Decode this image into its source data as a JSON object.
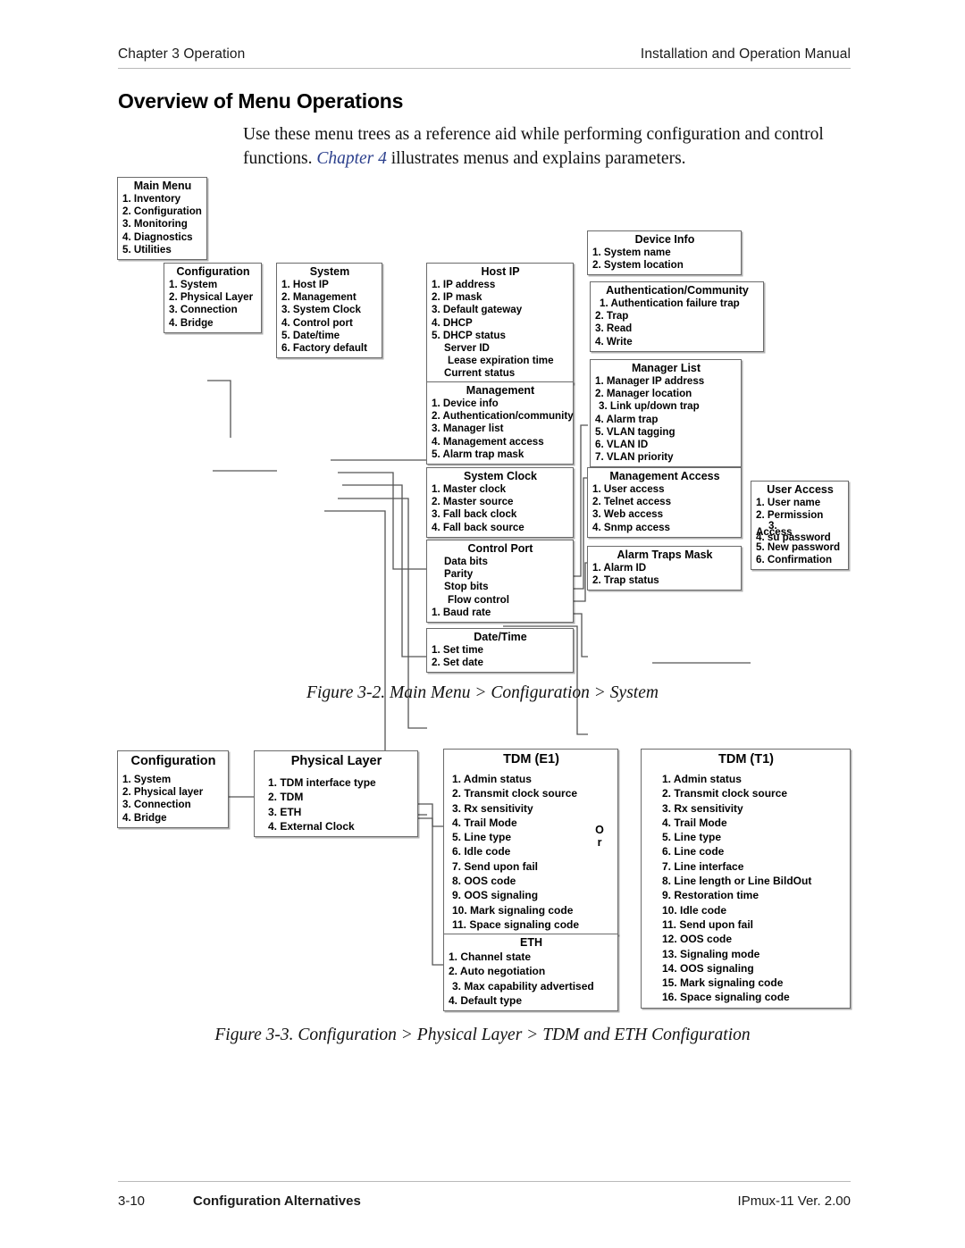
{
  "header": {
    "left": "Chapter 3  Operation",
    "right": "Installation and Operation Manual"
  },
  "section": {
    "title": "Overview of Menu Operations",
    "intro_part1": "Use these menu trees as a reference aid while performing configuration and control functions. ",
    "intro_xref": "Chapter 4",
    "intro_part2": " illustrates menus and explains parameters."
  },
  "figure1": {
    "caption": "Figure 3-2.  Main Menu > Configuration > System",
    "boxes": {
      "main_menu": {
        "title": "Main Menu",
        "items": [
          "1. Inventory",
          "2. Configuration",
          "3. Monitoring",
          "4. Diagnostics",
          "5. Utilities"
        ]
      },
      "configuration": {
        "title": "Configuration",
        "items": [
          "1. System",
          "2. Physical Layer",
          "3. Connection",
          "4. Bridge"
        ]
      },
      "system": {
        "title": "System",
        "items": [
          "1. Host IP",
          "2. Management",
          "3. System Clock",
          "4. Control port",
          "5. Date/time",
          "6. Factory default"
        ]
      },
      "host_ip": {
        "title": "Host IP",
        "items": [
          "1. IP address",
          "2. IP mask",
          "3. Default gateway",
          "4. DHCP",
          "5. DHCP status"
        ],
        "subitems": [
          "Server ID",
          "Lease expiration time",
          "Current status"
        ]
      },
      "device_info": {
        "title": "Device Info",
        "items": [
          "1. System name",
          "2. System location"
        ]
      },
      "authentication_community": {
        "title": "Authentication/Community",
        "items": [
          "1. Authentication failure trap",
          "2. Trap",
          "3. Read",
          "4. Write"
        ]
      },
      "management": {
        "title": "Management",
        "items": [
          "1. Device info",
          "2. Authentication/community",
          "3. Manager list",
          "4. Management access",
          "5. Alarm trap mask"
        ]
      },
      "manager_list": {
        "title": "Manager List",
        "items": [
          "1. Manager IP address",
          "2. Manager location",
          "3. Link up/down trap",
          "4. Alarm trap",
          "5. VLAN tagging",
          "6. VLAN ID",
          "7. VLAN priority"
        ]
      },
      "system_clock": {
        "title": "System Clock",
        "items": [
          "1. Master clock",
          "2. Master source",
          "3. Fall back clock",
          "4. Fall back source"
        ]
      },
      "management_access": {
        "title": "Management Access",
        "items": [
          "1. User access",
          "2. Telnet access",
          "3. Web access",
          "4. Snmp access"
        ]
      },
      "user_access": {
        "title": "User  Access",
        "items": [
          "1. User name",
          "2. Permission"
        ],
        "overlap_a": "3.",
        "overlap_b": "Access",
        "overlap_c": "4. su password",
        "items_tail": [
          "5. New password",
          "6. Confirmation"
        ]
      },
      "control_port": {
        "title": "Control Port",
        "subitems": [
          "Data bits",
          "Parity",
          "Stop bits",
          "Flow control"
        ],
        "items": [
          "1. Baud rate"
        ]
      },
      "alarm_traps_mask": {
        "title": "Alarm Traps Mask",
        "items": [
          "1. Alarm ID",
          "2. Trap status"
        ]
      },
      "date_time": {
        "title": "Date/Time",
        "items": [
          "1. Set time",
          "2. Set date"
        ]
      }
    }
  },
  "figure2": {
    "caption": "Figure 3-3.  Configuration > Physical Layer > TDM and ETH Configuration",
    "or_label_line1": "O",
    "or_label_line2": "r",
    "boxes": {
      "configuration": {
        "title": "Configuration",
        "items": [
          "1. System",
          "2. Physical layer",
          "3. Connection",
          "4. Bridge"
        ]
      },
      "physical_layer": {
        "title": "Physical Layer",
        "items": [
          "1. TDM interface type",
          "2. TDM",
          "3. ETH",
          "4. External Clock"
        ]
      },
      "tdm_e1": {
        "title": "TDM  (E1)",
        "items": [
          "1.   Admin status",
          "2.   Transmit clock source",
          "3.   Rx sensitivity",
          "4.   Trail Mode",
          "5.   Line type",
          "6.   Idle code",
          "7.   Send upon fail",
          "8.   OOS code",
          "9.   OOS signaling",
          "10. Mark signaling code",
          "11. Space signaling code"
        ]
      },
      "tdm_t1": {
        "title": "TDM (T1)",
        "items": [
          "1.   Admin status",
          "2.   Transmit clock source",
          "3.   Rx sensitivity",
          "4.   Trail Mode",
          "5.   Line type",
          "6.   Line code",
          "7.   Line interface",
          "8.   Line length or Line BildOut",
          "9.   Restoration time",
          "10. Idle code",
          "11. Send upon fail",
          "12. OOS code",
          "13. Signaling mode",
          "14. OOS signaling",
          "15. Mark signaling code",
          "16. Space signaling code"
        ]
      },
      "eth": {
        "title": "ETH",
        "items": [
          "1. Channel state",
          "2. Auto negotiation",
          "3. Max capability advertised",
          "4. Default type"
        ]
      }
    }
  },
  "footer": {
    "page": "3-10",
    "title": "Configuration Alternatives",
    "product": "IPmux-11 Ver. 2.00"
  },
  "colors": {
    "rule": "#b9b9b9",
    "box_border": "#6b6b6b",
    "wire": "#555555",
    "xref": "#2b3f8c"
  }
}
